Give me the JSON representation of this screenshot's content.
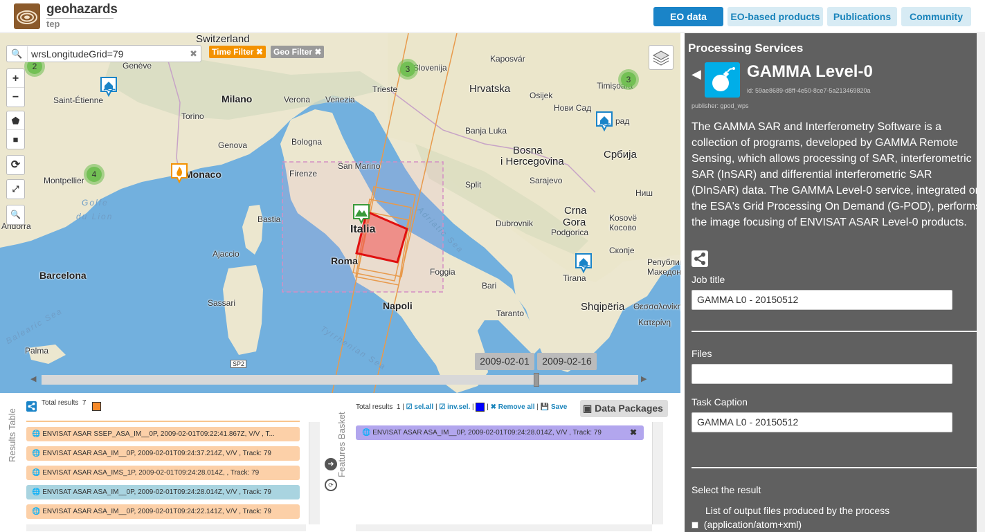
{
  "header": {
    "logo_name": "geohazards",
    "logo_sub": "tep",
    "nav": [
      {
        "label": "EO data",
        "active": true
      },
      {
        "label": "EO-based products",
        "active": false
      },
      {
        "label": "Publications",
        "active": false
      },
      {
        "label": "Community",
        "active": false
      }
    ]
  },
  "map": {
    "search": {
      "value": "wrsLongitudeGrid=79",
      "icon": "search-icon"
    },
    "filters": [
      {
        "label": "Time Filter",
        "color": "#f39200"
      },
      {
        "label": "Geo Filter",
        "color": "#9a9a9a"
      }
    ],
    "controls": {
      "zoom_in": "+",
      "zoom_out": "−"
    },
    "clusters": [
      {
        "count": "2"
      },
      {
        "count": "3"
      },
      {
        "count": "3"
      },
      {
        "count": "4"
      }
    ],
    "places": {
      "switzerland": "Switzerland",
      "slovenija": "Slovenija",
      "kaposvar": "Kaposvár",
      "geneve": "Genève",
      "milano": "Milano",
      "verona": "Verona",
      "venezia": "Venezia",
      "trieste": "Trieste",
      "hrvatska": "Hrvatska",
      "osijek": "Osijek",
      "timisoara": "Timișoara",
      "saint_etienne": "Saint-Étienne",
      "torino": "Torino",
      "genova": "Genova",
      "bologna": "Bologna",
      "novi_sad": "Нови Сад",
      "beograd": "рад",
      "banja_luka": "Banja Luka",
      "monaco": "Monaco",
      "firenze": "Firenze",
      "san_marino": "San Marino",
      "bosna": "Bosna",
      "hercegovina": "i Hercegovina",
      "srbija": "Србија",
      "montpellier": "Montpellier",
      "split": "Split",
      "sarajevo": "Sarajevo",
      "nis": "Ниш",
      "golfe": "Golfe",
      "du_lion": "du Lion",
      "bastia": "Bastia",
      "italia": "Italia",
      "dubrovnik": "Dubrovnik",
      "crna": "Crna",
      "gora": "Gora",
      "kosove": "Kosovë",
      "kosovo": "Косово",
      "andorra": "Andorra",
      "podgorica": "Podgorica",
      "ajaccio": "Ajaccio",
      "roma": "Roma",
      "skopje": "Скопје",
      "republika": "Република",
      "makedonija": "Македонија",
      "barcelona": "Barcelona",
      "foggia": "Foggia",
      "tirana": "Tirana",
      "bari": "Bari",
      "sassari": "Sassari",
      "napoli": "Napoli",
      "shqiperia": "Shqipëria",
      "thessaloniki": "Θεσσαλονίκη",
      "adriatic": "Adriatic Sea",
      "balearic": "Balearic Sea",
      "taranto": "Taranto",
      "katerini": "Κατερίνη",
      "tyrrhenian": "Tyrrhenian Sea",
      "palma": "Palma",
      "sp2": "SP2"
    },
    "timeline": {
      "start": "2009-02-01",
      "end": "2009-02-16"
    }
  },
  "results": {
    "tab_label": "Results Table",
    "total_label": "Total results",
    "total_count": "7",
    "color": "#f68a2a",
    "rows": [
      {
        "text": "ENVISAT ASAR SSEP_ASA_IM__0P, 2009-02-01T09:22:41.867Z, V/V , T...",
        "style": "orange"
      },
      {
        "text": "ENVISAT ASAR ASA_IM__0P, 2009-02-01T09:24:37.214Z, V/V , Track: 79",
        "style": "orange"
      },
      {
        "text": "ENVISAT ASAR ASA_IMS_1P, 2009-02-01T09:24:28.014Z, , Track: 79",
        "style": "orange"
      },
      {
        "text": "ENVISAT ASAR ASA_IM__0P, 2009-02-01T09:24:28.014Z, V/V , Track: 79",
        "style": "blue"
      },
      {
        "text": "ENVISAT ASAR ASA_IM__0P, 2009-02-01T09:24:22.141Z, V/V , Track: 79",
        "style": "orange"
      }
    ]
  },
  "basket": {
    "tab_label": "Features Basket",
    "total_label": "Total results",
    "total_count": "1",
    "sel_all": "sel.all",
    "inv_sel": "inv.sel.",
    "remove_all": "Remove all",
    "save": "Save",
    "color": "#0000ff",
    "data_packages": "Data Packages",
    "row": "ENVISAT ASAR ASA_IM__0P, 2009-02-01T09:24:28.014Z, V/V , Track: 79"
  },
  "panel": {
    "title": "Processing Services",
    "service_name": "GAMMA Level-0",
    "service_id": "id: 59ae8689-d8ff-4e50-8ce7-5a213469820a",
    "publisher": "publisher: gpod_wps",
    "description": "The GAMMA SAR and Interferometry Software is a collection of programs, developed by GAMMA Remote Sensing, which allows processing of SAR, interferometric SAR (InSAR) and differential interferometric SAR (DInSAR) data. The GAMMA Level-0 service, integrated on the ESA's Grid Processing On Demand (G-POD), performs the image focusing of ENVISAT ASAR Level-0 products.",
    "job_title_label": "Job title",
    "job_title_value": "GAMMA L0 - 20150512",
    "files_label": "Files",
    "files_value": "",
    "task_caption_label": "Task Caption",
    "task_caption_value": "GAMMA L0 - 20150512",
    "select_result_label": "Select the result",
    "result_option_line1": "List of output files produced by the process",
    "result_option_line2": "(application/atom+xml)",
    "icon_color": "#00aee8"
  }
}
